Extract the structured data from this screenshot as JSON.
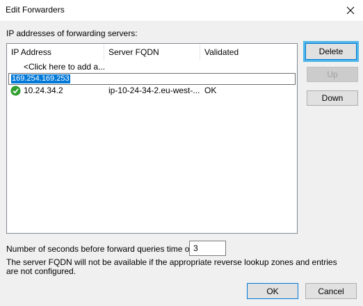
{
  "dialog": {
    "title": "Edit Forwarders",
    "close_icon": "close-icon"
  },
  "list": {
    "label": "IP addresses of forwarding servers:",
    "columns": [
      "IP Address",
      "Server FQDN",
      "Validated"
    ],
    "add_placeholder": "<Click here to add a...",
    "editing_value": "169.254.169.253",
    "rows": [
      {
        "status_icon": "check-ok-icon",
        "ip": "10.24.34.2",
        "fqdn": "ip-10-24-34-2.eu-west-...",
        "validated": "OK"
      }
    ]
  },
  "side_buttons": {
    "delete": "Delete",
    "up": "Up",
    "down": "Down"
  },
  "timeout": {
    "label": "Number of seconds before forward queries time out:",
    "value": "3"
  },
  "note": "The server FQDN will not be available if the appropriate reverse lookup zones and entries are not configured.",
  "footer": {
    "ok": "OK",
    "cancel": "Cancel"
  },
  "colors": {
    "accent": "#0078d7",
    "focus_ring": "#4fb6e8",
    "ok_green": "#2e9e2e"
  }
}
